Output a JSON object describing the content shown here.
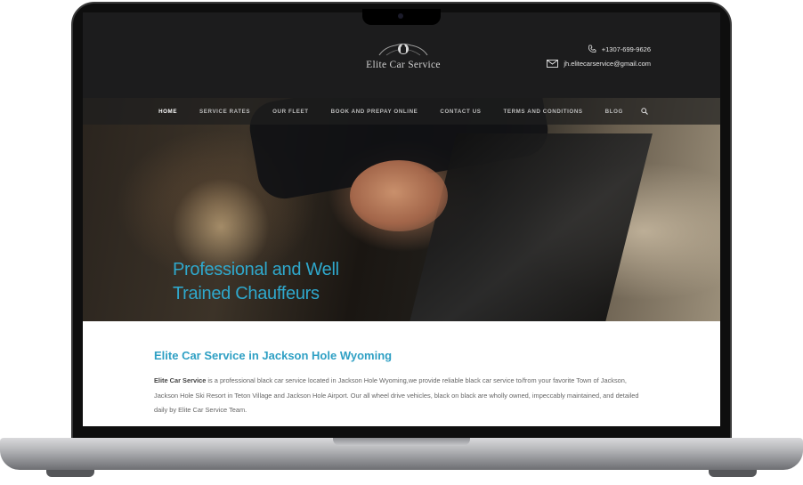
{
  "header": {
    "logo_text": "Elite Car Service",
    "phone": "+1307-699-9626",
    "email": "jh.elitecarservice@gmail.com",
    "phone_icon": "phone-icon",
    "email_icon": "envelope-icon"
  },
  "nav": {
    "items": [
      {
        "label": "HOME"
      },
      {
        "label": "SERVICE RATES"
      },
      {
        "label": "OUR FLEET"
      },
      {
        "label": "BOOK AND PREPAY ONLINE"
      },
      {
        "label": "CONTACT US"
      },
      {
        "label": "TERMS AND CONDITIONS"
      },
      {
        "label": "BLOG"
      }
    ],
    "search_icon": "search-icon"
  },
  "hero": {
    "title_line1": "Professional and Well",
    "title_line2": "Trained Chauffeurs"
  },
  "main": {
    "heading": "Elite Car Service in Jackson Hole Wyoming",
    "intro_bold": "Elite Car Service",
    "intro_text": " is a professional black car service located in Jackson Hole Wyoming,we provide  reliable black car service to/from your favorite Town of Jackson, Jackson Hole Ski Resort in Teton Village and Jackson Hole Airport. Our all wheel drive vehicles, black on black are wholly owned, impeccably maintained, and detailed daily by Elite Car Service Team."
  },
  "colors": {
    "accent": "#2fa8cc",
    "header_bg": "#1c1c1d",
    "nav_text": "#bdbdbd",
    "body_text": "#666666"
  }
}
